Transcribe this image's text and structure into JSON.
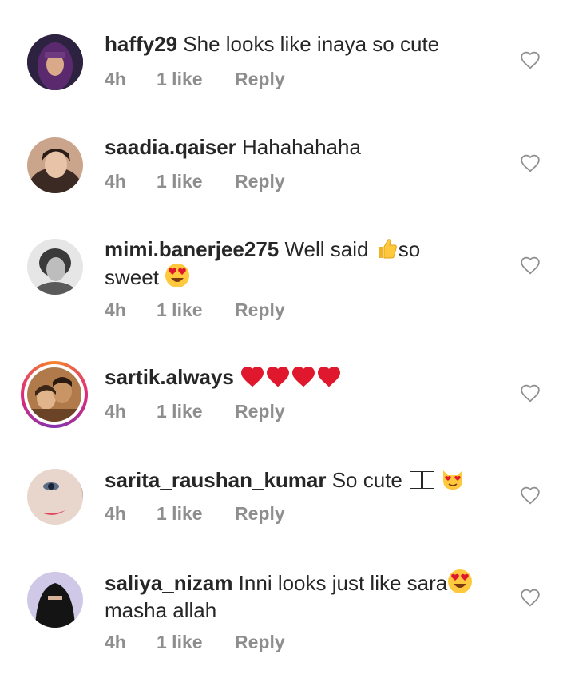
{
  "comments": [
    {
      "username": "haffy29",
      "text": "She looks like inaya so cute",
      "time": "4h",
      "likes": "1 like",
      "reply": "Reply"
    },
    {
      "username": "saadia.qaiser",
      "text": "Hahahahaha",
      "time": "4h",
      "likes": "1 like",
      "reply": "Reply"
    },
    {
      "username": "mimi.banerjee275",
      "text_a": "Well said",
      "text_b": "so",
      "text_c": "sweet",
      "time": "4h",
      "likes": "1 like",
      "reply": "Reply"
    },
    {
      "username": "sartik.always",
      "time": "4h",
      "likes": "1 like",
      "reply": "Reply"
    },
    {
      "username": "sarita_raushan_kumar",
      "text": "So cute",
      "time": "4h",
      "likes": "1 like",
      "reply": "Reply"
    },
    {
      "username": "saliya_nizam",
      "text_a": "Inni looks just like sara",
      "text_b": "masha allah",
      "time": "4h",
      "likes": "1 like",
      "reply": "Reply"
    }
  ],
  "colors": {
    "text": "#262626",
    "muted": "#8e8e8e",
    "heart_emoji": "#e0182d",
    "story_ring": "#dd2a7b"
  },
  "icons": {
    "like": "heart-outline-icon"
  }
}
